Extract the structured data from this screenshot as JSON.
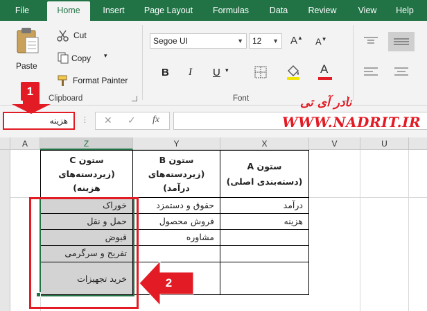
{
  "ribbon_tabs": [
    "File",
    "Home",
    "Insert",
    "Page Layout",
    "Formulas",
    "Data",
    "Review",
    "View",
    "Help"
  ],
  "active_tab": "Home",
  "clipboard": {
    "paste": "Paste",
    "cut": "Cut",
    "copy": "Copy",
    "format_painter": "Format Painter",
    "group_label": "Clipboard"
  },
  "font": {
    "font_name": "Segoe UI",
    "font_size": "12",
    "group_label": "Font",
    "bold": "B",
    "italic": "I",
    "underline": "U",
    "font_color_letter": "A"
  },
  "formula_bar": {
    "name_box": "هزینه",
    "fx": "fx",
    "formula": ""
  },
  "columns": [
    "A",
    "Z",
    "Y",
    "X",
    "V",
    "U"
  ],
  "selected_column": "Z",
  "headers": {
    "z": [
      "ستون C",
      "(زیردسته‌های",
      "هزینه)"
    ],
    "y": [
      "ستون B",
      "(زیردسته‌های",
      "درآمد)"
    ],
    "x": [
      "ستون A",
      "(دسته‌بندی اصلی)"
    ]
  },
  "column_z": [
    "خوراک",
    "حمل و نقل",
    "قبوض",
    "تفریح و سرگرمی",
    "خرید تجهیزات"
  ],
  "column_y": [
    "حقوق و دستمزد",
    "فروش محصول",
    "مشاوره",
    "",
    ""
  ],
  "column_x": [
    "درآمد",
    "هزینه",
    "",
    "",
    ""
  ],
  "annotations": {
    "badge_1": "1",
    "badge_2": "2",
    "watermark_fa": "نادر آی تی",
    "watermark_url": "WWW.NADRIT.IR"
  },
  "colors": {
    "excel_green": "#217346",
    "annotation_red": "#e21b24",
    "selection_gray": "#d3d3d3"
  }
}
